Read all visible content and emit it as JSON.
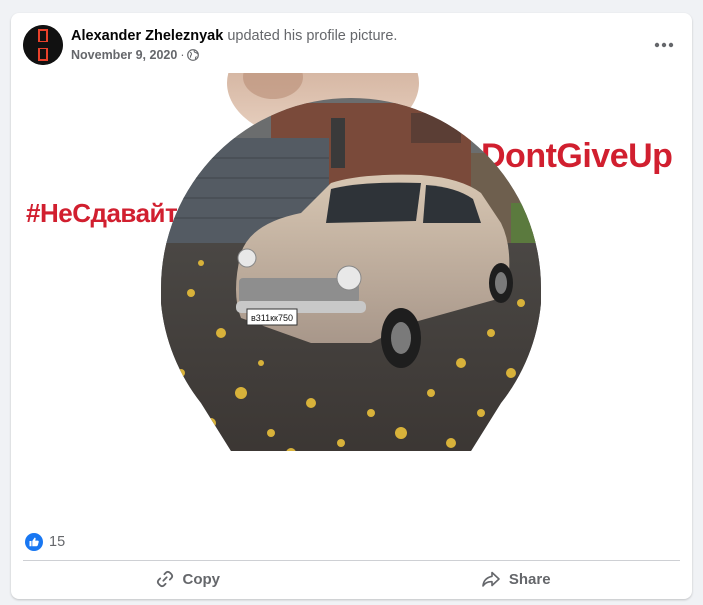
{
  "post": {
    "author_name": "Alexander Zheleznyak",
    "action_text": "updated his profile picture.",
    "date": "November 9, 2020",
    "separator": "·",
    "privacy_icon": "globe-icon",
    "menu_icon": "more-horizontal-icon"
  },
  "media": {
    "frame_text_left": "#НеСдавайт",
    "frame_text_right": "DontGiveUp",
    "plate_text": "в311кк750",
    "frame_text_color": "#d11f2f"
  },
  "reactions": {
    "icon": "like-icon",
    "count": "15",
    "color": "#1877f2"
  },
  "actions": {
    "copy_label": "Copy",
    "copy_icon": "link-icon",
    "share_label": "Share",
    "share_icon": "share-arrow-icon"
  }
}
